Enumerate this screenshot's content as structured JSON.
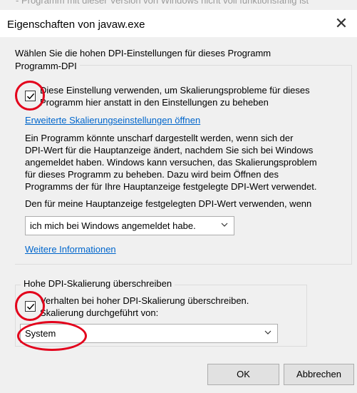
{
  "background_text": "- Programm mit dieser Version von Windows nicht voll funktionsfähig ist",
  "window": {
    "title": "Eigenschaften von javaw.exe",
    "close_label": "✕"
  },
  "intro": "Wählen Sie die hohen DPI-Einstellungen für dieses Programm",
  "program_dpi": {
    "group_label": "Programm-DPI",
    "checkbox_checked": true,
    "checkbox_line1": "Diese Einstellung verwenden, um Skalierungsprobleme für dieses",
    "checkbox_line2": "Programm hier anstatt in den Einstellungen zu beheben",
    "advanced_link": "Erweiterte Skalierungseinstellungen öffnen",
    "desc_line1": "Ein Programm könnte unscharf dargestellt werden, wenn sich der",
    "desc_line2": "DPI-Wert für die Hauptanzeige ändert, nachdem Sie sich bei Windows",
    "desc_line3": "angemeldet haben. Windows kann versuchen, das Skalierungsproblem",
    "desc_line4": "für dieses Programm zu beheben. Dazu wird beim Öffnen des",
    "desc_line5": "Programms der für Ihre Hauptanzeige festgelegte DPI-Wert verwendet.",
    "use_line": "Den für meine Hauptanzeige festgelegten DPI-Wert verwenden, wenn",
    "dropdown_value": "ich mich bei Windows angemeldet habe.",
    "more_info_link": "Weitere Informationen"
  },
  "override": {
    "group_label": "Hohe DPI-Skalierung überschreiben",
    "checkbox_checked": true,
    "checkbox_line1": "Verhalten bei hoher DPI-Skalierung überschreiben.",
    "checkbox_line2": "Skalierung durchgeführt von:",
    "dropdown_value": "System"
  },
  "buttons": {
    "ok": "OK",
    "cancel": "Abbrechen"
  },
  "annotation_color": "#e3001b"
}
